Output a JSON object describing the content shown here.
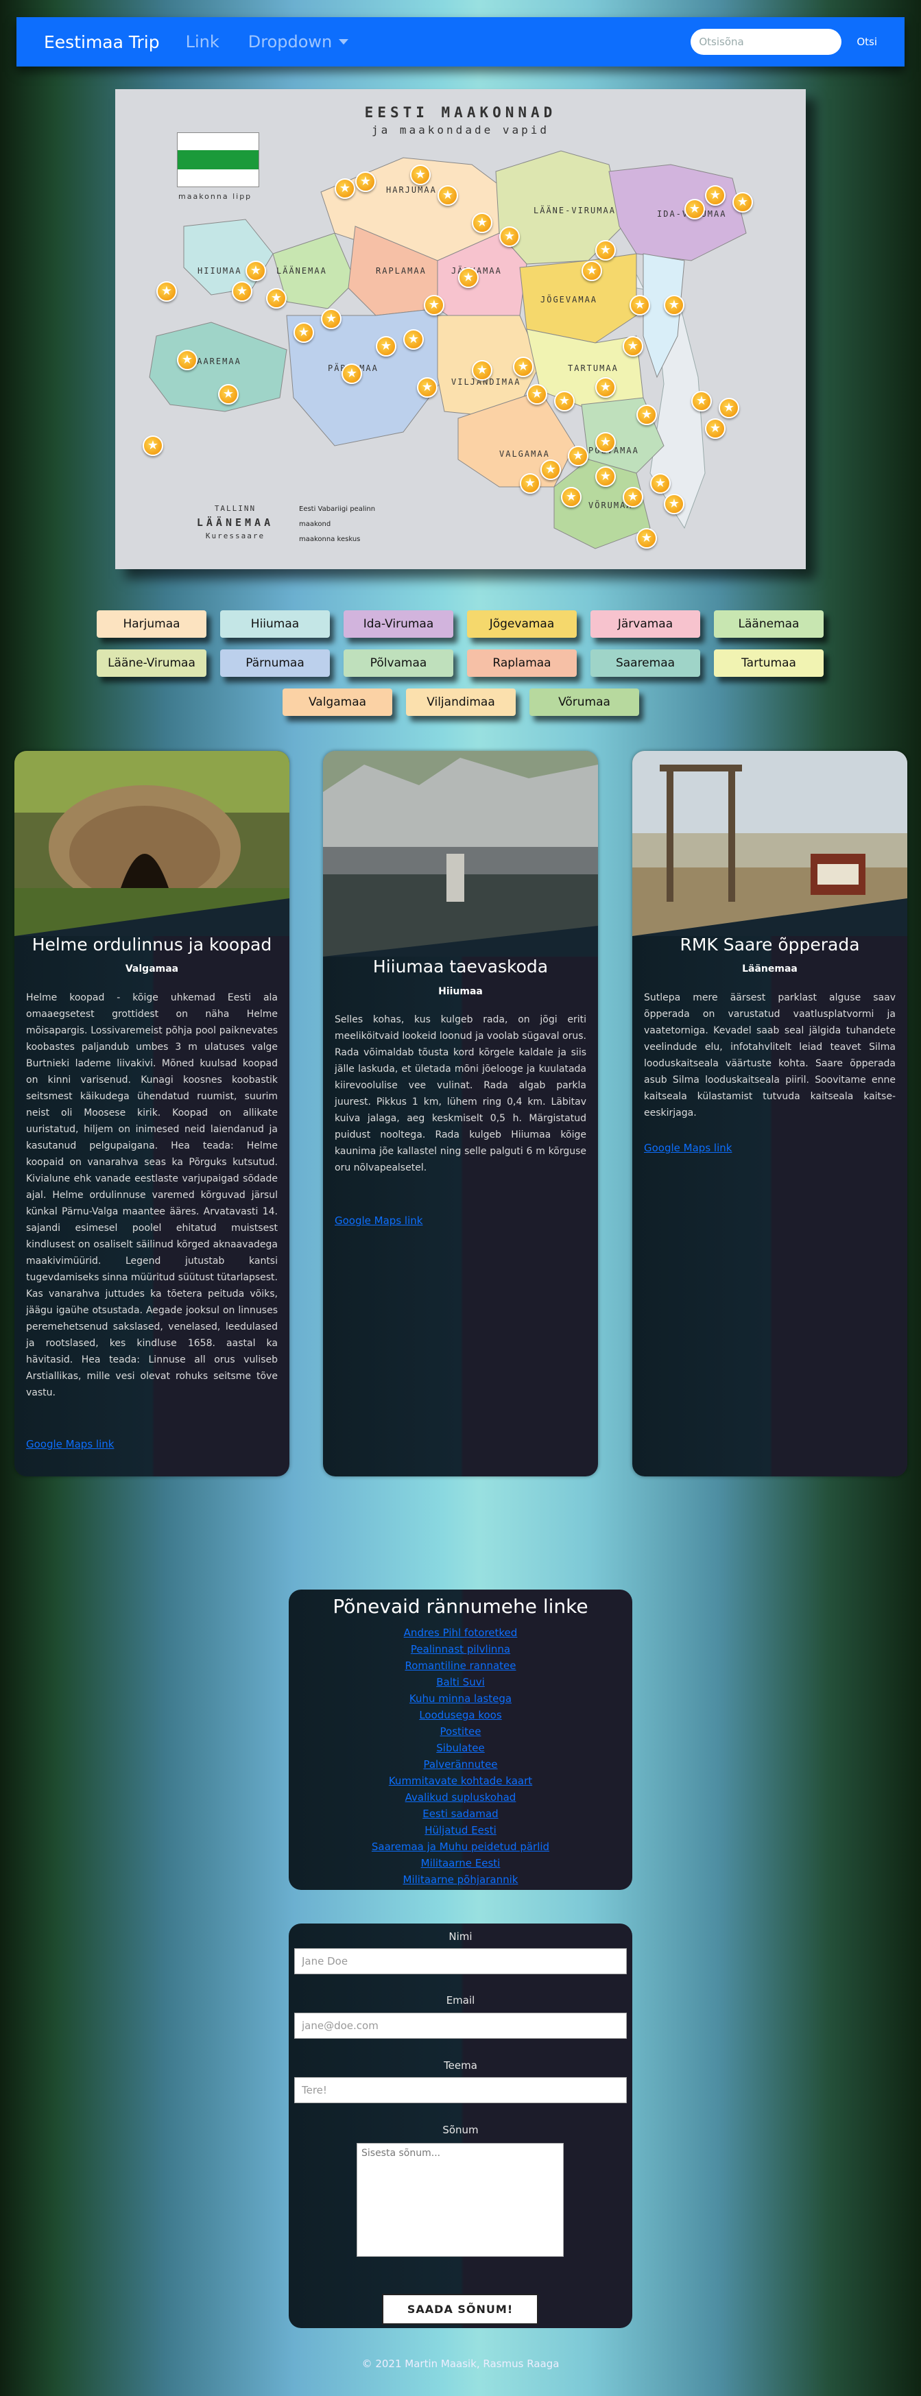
{
  "navbar": {
    "brand": "Eestimaa Trip",
    "link": "Link",
    "dropdown": "Dropdown",
    "search_placeholder": "Otsisõna",
    "search_button": "Otsi"
  },
  "map": {
    "title": "EESTI MAAKONNAD",
    "subtitle": "ja maakondade vapid",
    "flag_label": "maakonna lipp",
    "legend_city_top": "TALLINN",
    "legend_county": "LÄÄNEMAA",
    "legend_city_bottom": "Kuressaare",
    "legend_items": [
      "Eesti Vabariigi pealinn",
      "maakond",
      "maakonna keskus"
    ],
    "county_labels": [
      "HARJUMAA",
      "LÄÄNE-VIRUMAA",
      "IDA-VIRUMAA",
      "HIIUMAA",
      "LÄÄNEMAA",
      "RAPLAMAA",
      "JÄRVAMAA",
      "JÕGEVAMAA",
      "SAAREMAA",
      "PÄRNUMAA",
      "VILJANDIMAA",
      "TARTUMAA",
      "PÕLVAMAA",
      "VALGAMAA",
      "VÕRUMAA"
    ]
  },
  "counties": [
    [
      "Harjumaa",
      "Hiiumaa",
      "Ida-Virumaa",
      "Jõgevamaa",
      "Järvamaa",
      "Läänemaa"
    ],
    [
      "Lääne-Virumaa",
      "Pärnumaa",
      "Põlvamaa",
      "Raplamaa",
      "Saaremaa",
      "Tartumaa"
    ],
    [
      "Valgamaa",
      "Viljandimaa",
      "Võrumaa"
    ]
  ],
  "county_colors": {
    "Harjumaa": "#fce3c0",
    "Hiiumaa": "#c4e6e6",
    "Ida-Virumaa": "#d2b4dd",
    "Jõgevamaa": "#f5d86c",
    "Järvamaa": "#f7c3ce",
    "Läänemaa": "#c8e6b1",
    "Lääne-Virumaa": "#dde6b0",
    "Pärnumaa": "#bcd0ec",
    "Põlvamaa": "#bfe0bc",
    "Raplamaa": "#f6c0a6",
    "Saaremaa": "#9fd4c8",
    "Tartumaa": "#f1f3b2",
    "Valgamaa": "#fbd2a5",
    "Viljandimaa": "#fbe0ad",
    "Võrumaa": "#b7d99e"
  },
  "cards": [
    {
      "title": "Helme ordulinnus ja koopad",
      "county": "Valgamaa",
      "text": "Helme koopad - kõige uhkemad Eesti ala omaaegsetest grottidest on näha Helme mõisapargis. Lossivaremeist põhja pool paiknevates koobastes paljandub umbes 3 m ulatuses valge Burtnieki lademe liivakivi. Mõned kuulsad koopad on kinni varisenud. Kunagi koosnes koobastik seitsmest käikudega ühendatud ruumist, suurim neist oli Moosese kirik. Koopad on allikate uuristatud, hiljem on inimesed neid laiendanud ja kasutanud pelgupaigana. Hea teada: Helme koopaid on vanarahva seas ka Põrguks kutsutud. Kivialune ehk vanade eestlaste varjupaigad sõdade ajal. Helme ordulinnuse varemed kõrguvad järsul künkal Pärnu-Valga maantee ääres. Arvatavasti 14. sajandi esimesel poolel ehitatud muistsest kindlusest on osaliselt säilinud kõrged akna­avadega maakivimüürid. Legend jutustab kantsi tugevdamiseks sinna müüritud süütust tütarlapsest. Kas vanarahva juttudes ka tõetera peituda võiks, jäägu igaühe otsustada. Aegade jooksul on linnuses peremehetsenud sakslased, venelased, leedulased ja rootslased, kes kindluse 1658. aastal ka hävitasid. Hea teada: Linnuse all orus vuliseb Arstiallikas, mille vesi olevat rohuks seitsme tõve vastu.",
      "link": "Google Maps link",
      "image": "cave-photo"
    },
    {
      "title": "Hiiumaa taevaskoda",
      "county": "Hiiumaa",
      "text": "Selles kohas, kus kulgeb rada, on jõgi eriti meeliköitvaid lookeid loonud ja voolab sügaval orus. Rada võimaldab tõusta kord kõrgele kaldale ja siis jälle laskuda, et ületada mõni jõelooge ja kuulatada kiirevoolulise vee vulinat. Rada algab parkla juurest. Pikkus 1 km, lühem ring 0,4 km. Läbitav kuiva jalaga, aeg keskmiselt 0,5 h. Märgistatud puidust nooltega. Rada kulgeb Hiiumaa kõige kaunima jõe kallastel ning selle palguti 6 m kõrguse oru nõlvapealsetel.",
      "link": "Google Maps link",
      "image": "river-photo"
    },
    {
      "title": "RMK Saare õpperada",
      "county": "Läänemaa",
      "text": "Sutlepa mere äärsest parklast alguse saav õpperada on varustatud vaatlusplatvormi ja vaatetorniga. Kevadel saab seal jälgida tuhandete veelindude elu, infotahvlitelt leiad teavet Silma looduskaitseala väärtuste kohta. Saare õpperada asub Silma looduskaitseala piiril. Soovitame enne kaitseala külastamist tutvuda kaitseala kaitse-eeskirjaga.",
      "link": "Google Maps link",
      "image": "tower-photo"
    }
  ],
  "links_box": {
    "title": "Põnevaid rännumehe linke",
    "links": [
      "Andres Pihl fotoretked",
      "Pealinnast pilvlinna",
      "Romantiline rannatee",
      "Balti Suvi",
      "Kuhu minna lastega",
      "Loodusega koos",
      "Postitee",
      "Sibulatee",
      "Palverännutee",
      "Kummitavate kohtade kaart",
      "Avalikud supluskohad",
      "Eesti sadamad",
      "Hüljatud Eesti",
      "Saaremaa ja Muhu peidetud pärlid",
      "Militaarne Eesti",
      "Militaarne põhjarannik"
    ]
  },
  "form": {
    "name_label": "Nimi",
    "name_placeholder": "Jane Doe",
    "email_label": "Email",
    "email_placeholder": "jane@doe.com",
    "topic_label": "Teema",
    "topic_placeholder": "Tere!",
    "message_label": "Sõnum",
    "message_placeholder": "Sisesta sõnum...",
    "submit": "SAADA SÕNUM!"
  },
  "footer": "© 2021 Martin Maasik, Rasmus Raaga"
}
